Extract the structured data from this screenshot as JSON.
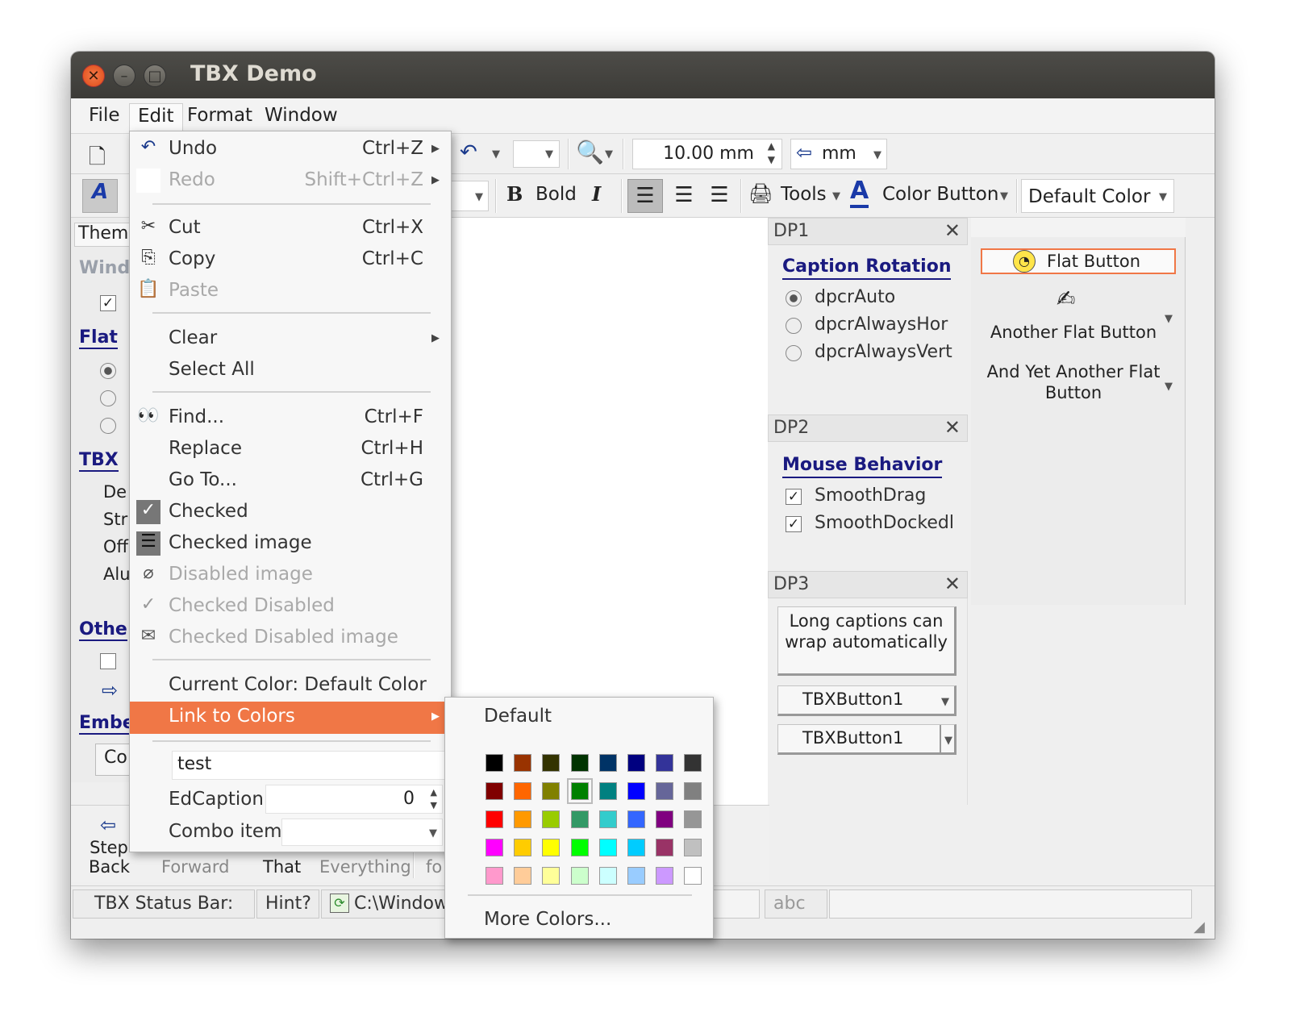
{
  "window": {
    "title": "TBX Demo"
  },
  "menubar": [
    "File",
    "Edit",
    "Format",
    "Window"
  ],
  "toolbar1": {
    "size_value": "10.00 mm",
    "unit": "mm"
  },
  "toolbar2": {
    "bold": "Bold",
    "tools": "Tools",
    "color_button": "Color Button",
    "default_color": "Default Color"
  },
  "left_panel": {
    "theme_tab": "Them",
    "win_heading": "Wind",
    "flat_heading": "Flat",
    "tbx_heading": "TBX",
    "tbx_items": [
      "De",
      "Str",
      "Off",
      "Alu"
    ],
    "other_heading": "Othe",
    "embed_heading": "Embe",
    "embed_button": "Co"
  },
  "bottom_toolbar": {
    "step_back": "Step Back",
    "forward": "Forward",
    "that": "That",
    "everything": "Everything",
    "fo": "fo"
  },
  "dp1": {
    "title": "DP1",
    "caption": "Caption Rotation",
    "options": [
      "dpcrAuto",
      "dpcrAlwaysHor",
      "dpcrAlwaysVert"
    ]
  },
  "dp2": {
    "title": "DP2",
    "caption": "Mouse Behavior",
    "options": [
      "SmoothDrag",
      "SmoothDockedl"
    ]
  },
  "dp3": {
    "title": "DP3",
    "long_button": "Long captions can wrap automatically",
    "tbx1": "TBXButton1",
    "tbx2": "TBXButton1"
  },
  "flat_panel": {
    "flat": "Flat Button",
    "another": "Another Flat Button",
    "yet_another": "And Yet Another Flat Button"
  },
  "status": {
    "label": "TBX Status Bar:",
    "hint": "Hint?",
    "path": "C:\\Window",
    "abc": "abc"
  },
  "edit_menu": {
    "undo": "Undo",
    "undo_sc": "Ctrl+Z",
    "redo": "Redo",
    "redo_sc": "Shift+Ctrl+Z",
    "cut": "Cut",
    "cut_sc": "Ctrl+X",
    "copy": "Copy",
    "copy_sc": "Ctrl+C",
    "paste": "Paste",
    "clear": "Clear",
    "select_all": "Select All",
    "find": "Find...",
    "find_sc": "Ctrl+F",
    "replace": "Replace",
    "replace_sc": "Ctrl+H",
    "goto": "Go To...",
    "goto_sc": "Ctrl+G",
    "checked": "Checked",
    "checked_image": "Checked image",
    "disabled_image": "Disabled image",
    "checked_disabled": "Checked Disabled",
    "checked_disabled_image": "Checked Disabled image",
    "current_color": "Current Color: Default Color",
    "link_to_colors": "Link to Colors",
    "edit_value": "test",
    "edcaption": "EdCaption",
    "edcaption_value": "0",
    "combo_item": "Combo item"
  },
  "color_menu": {
    "default": "Default",
    "more": "More Colors...",
    "colors": [
      "#000000",
      "#993300",
      "#333300",
      "#003300",
      "#003366",
      "#000080",
      "#333399",
      "#333333",
      "#800000",
      "#ff6600",
      "#808000",
      "#008000",
      "#008080",
      "#0000ff",
      "#666699",
      "#808080",
      "#ff0000",
      "#ff9900",
      "#99cc00",
      "#339966",
      "#33cccc",
      "#3366ff",
      "#800080",
      "#969696",
      "#ff00ff",
      "#ffcc00",
      "#ffff00",
      "#00ff00",
      "#00ffff",
      "#00ccff",
      "#993366",
      "#c0c0c0",
      "#ff99cc",
      "#ffcc99",
      "#ffff99",
      "#ccffcc",
      "#ccffff",
      "#99ccff",
      "#cc99ff",
      "#ffffff"
    ]
  }
}
